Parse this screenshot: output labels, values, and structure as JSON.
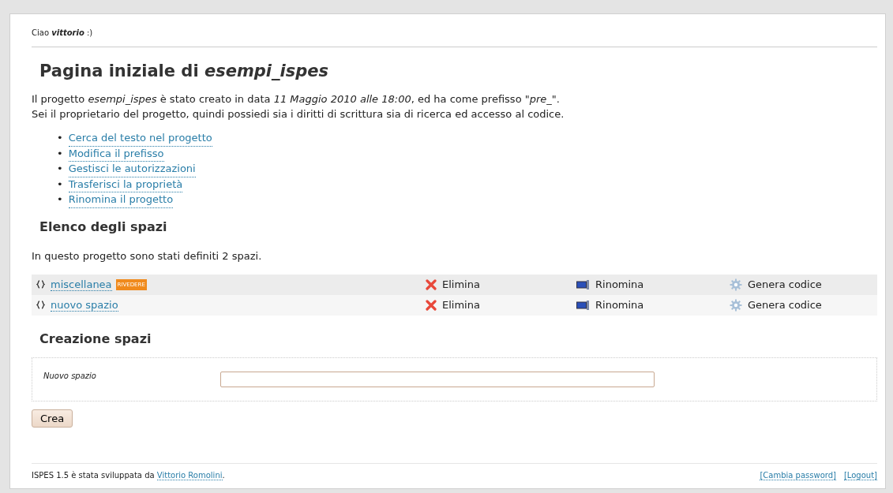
{
  "greeting": "Ciao **vittorio** :)",
  "title": "Pagina iniziale di *esempi_ispes*",
  "intro": [
    "Il progetto *esempi_ispes* è stato creato in data *11 Maggio 2010 alle 18:00*, ed ha come prefisso \"*pre_*\".",
    "Sei il proprietario del progetto, quindi possiedi sia i diritti di scrittura sia di ricerca ed accesso al codice."
  ],
  "actions": [
    {
      "bullet": "•",
      "label": "Cerca del testo nel progetto"
    },
    {
      "bullet": "•",
      "label": "Modifica il prefisso"
    },
    {
      "bullet": "•",
      "label": "Gestisci le autorizzazioni"
    },
    {
      "bullet": "•",
      "label": "Trasferisci la proprietà"
    },
    {
      "bullet": "•",
      "label": "Rinomina il progetto"
    }
  ],
  "spaces_heading": "Elenco degli spazi",
  "spaces_summary": "In questo progetto sono stati definiti 2 spazi.",
  "spaces": [
    {
      "name": "miscellanea",
      "badge": "RIVEDERE",
      "delete": "Elimina",
      "rename": "Rinomina",
      "generate": "Genera codice"
    },
    {
      "name": "nuovo spazio",
      "delete": "Elimina",
      "rename": "Rinomina",
      "generate": "Genera codice"
    }
  ],
  "create_heading": "Creazione spazi",
  "form": {
    "label": "Nuovo spazio",
    "submit": "Crea"
  },
  "footer": {
    "before": "ISPES 1.5 è stata sviluppata da ",
    "author": "Vittorio Romolini",
    "after": ".",
    "links": [
      "[Cambia password]",
      "[Logout]"
    ]
  }
}
